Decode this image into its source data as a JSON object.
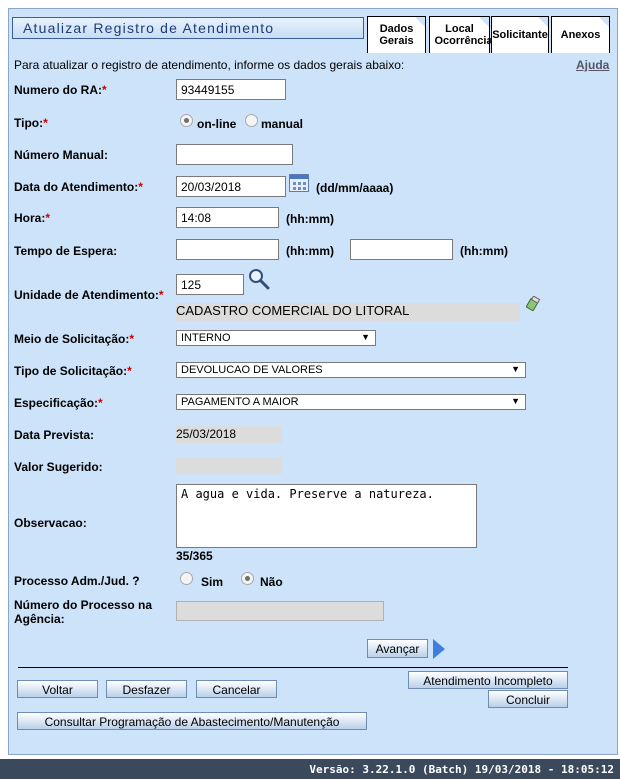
{
  "header": {
    "title": "Atualizar Registro de Atendimento",
    "tabs": [
      {
        "label": "Dados Gerais"
      },
      {
        "label": "Local Ocorrência"
      },
      {
        "label": "Solicitante"
      },
      {
        "label": "Anexos"
      }
    ]
  },
  "intro": "Para atualizar o registro de atendimento, informe os dados gerais abaixo:",
  "help_label": "Ajuda",
  "form": {
    "numero_ra": {
      "label": "Numero do RA:",
      "value": "93449155"
    },
    "tipo": {
      "label": "Tipo:",
      "options": [
        "on-line",
        "manual"
      ],
      "selected": "on-line"
    },
    "numero_manual": {
      "label": "Número Manual:",
      "value": ""
    },
    "data_atendimento": {
      "label": "Data do Atendimento:",
      "value": "20/03/2018",
      "hint": "(dd/mm/aaaa)"
    },
    "hora": {
      "label": "Hora:",
      "value": "14:08",
      "hint": "(hh:mm)"
    },
    "tempo_espera": {
      "label": "Tempo de Espera:",
      "value1": "",
      "value2": "",
      "hint1": "(hh:mm)",
      "hint2": "(hh:mm)"
    },
    "unidade": {
      "label": "Unidade de Atendimento:",
      "code": "125",
      "name": "CADASTRO COMERCIAL DO LITORAL"
    },
    "meio": {
      "label": "Meio de Solicitação:",
      "value": "INTERNO"
    },
    "tipo_solicitacao": {
      "label": "Tipo de Solicitação:",
      "value": "DEVOLUCAO DE VALORES"
    },
    "especificacao": {
      "label": "Especificação:",
      "value": "PAGAMENTO A MAIOR"
    },
    "data_prevista": {
      "label": "Data Prevista:",
      "value": "25/03/2018"
    },
    "valor_sugerido": {
      "label": "Valor Sugerido:",
      "value": ""
    },
    "observacao": {
      "label": "Observacao:",
      "value": "A agua e vida. Preserve a natureza.",
      "counter": "35/365"
    },
    "processo": {
      "label": "Processo Adm./Jud. ?",
      "options": [
        "Sim",
        "Não"
      ],
      "selected": "Não"
    },
    "numero_processo": {
      "label": "Número do Processo na Agência:",
      "value": ""
    }
  },
  "buttons": {
    "avancar": "Avançar",
    "voltar": "Voltar",
    "desfazer": "Desfazer",
    "cancelar": "Cancelar",
    "atendimento_incompleto": "Atendimento Incompleto",
    "concluir": "Concluir",
    "consultar": "Consultar Programação de Abastecimento/Manutenção"
  },
  "footer": "Versão: 3.22.1.0 (Batch) 19/03/2018 - 18:05:12",
  "colors": {
    "panel": "#cde3f9",
    "required": "#d00000",
    "footer": "#3a4a5c"
  }
}
